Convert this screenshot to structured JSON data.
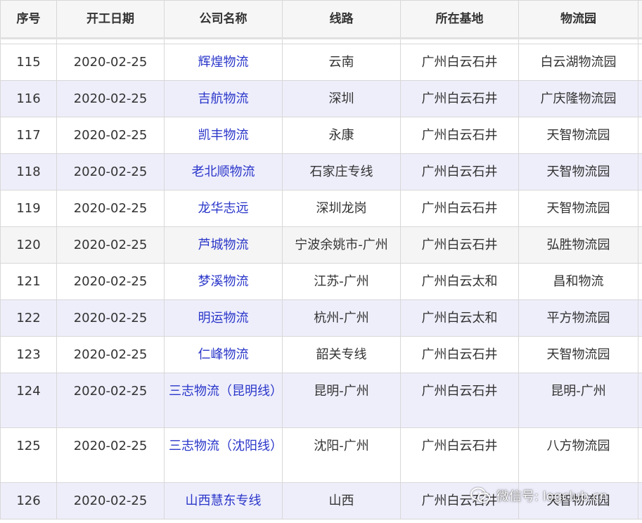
{
  "table": {
    "headers": [
      "序号",
      "开工日期",
      "公司名称",
      "线路",
      "所在基地",
      "物流园"
    ],
    "rows": [
      {
        "idx": "115",
        "date": "2020-02-25",
        "company": "辉煌物流",
        "route": "云南",
        "base": "广州白云石井",
        "park": "白云湖物流园"
      },
      {
        "idx": "116",
        "date": "2020-02-25",
        "company": "吉航物流",
        "route": "深圳",
        "base": "广州白云石井",
        "park": "广庆隆物流园"
      },
      {
        "idx": "117",
        "date": "2020-02-25",
        "company": "凯丰物流",
        "route": "永康",
        "base": "广州白云石井",
        "park": "天智物流园"
      },
      {
        "idx": "118",
        "date": "2020-02-25",
        "company": "老北顺物流",
        "route": "石家庄专线",
        "base": "广州白云石井",
        "park": "天智物流园"
      },
      {
        "idx": "119",
        "date": "2020-02-25",
        "company": "龙华志远",
        "route": "深圳龙岗",
        "base": "广州白云石井",
        "park": "天智物流园"
      },
      {
        "idx": "120",
        "date": "2020-02-25",
        "company": "芦城物流",
        "route": "宁波余姚市-广州",
        "base": "广州白云石井",
        "park": "弘胜物流园"
      },
      {
        "idx": "121",
        "date": "2020-02-25",
        "company": "梦溪物流",
        "route": "江苏-广州",
        "base": "广州白云太和",
        "park": "昌和物流"
      },
      {
        "idx": "122",
        "date": "2020-02-25",
        "company": "明运物流",
        "route": "杭州-广州",
        "base": "广州白云太和",
        "park": "平方物流园"
      },
      {
        "idx": "123",
        "date": "2020-02-25",
        "company": "仁峰物流",
        "route": "韶关专线",
        "base": "广州白云石井",
        "park": "天智物流园"
      },
      {
        "idx": "124",
        "date": "2020-02-25",
        "company": "三志物流（昆明线）",
        "route": "昆明-广州",
        "base": "广州白云石井",
        "park": "昆明-广州"
      },
      {
        "idx": "125",
        "date": "2020-02-25",
        "company": "三志物流（沈阳线）",
        "route": "沈阳-广州",
        "base": "广州白云石井",
        "park": "八方物流园"
      },
      {
        "idx": "126",
        "date": "2020-02-25",
        "company": "山西慧东专线",
        "route": "山西",
        "base": "广州白云石井",
        "park": "天智物流园"
      }
    ]
  },
  "watermark": {
    "text": "微信号: logclub.cn",
    "icon": "wechat-icon"
  },
  "colors": {
    "company_link": "#2a36c9",
    "alt_row": "#eeeefb",
    "gray_row": "#f5f5f5"
  }
}
